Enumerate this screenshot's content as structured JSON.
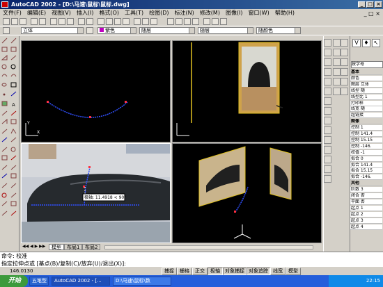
{
  "window": {
    "title": "AutoCAD 2002 - [D:\\马速\\鼠标\\鼠标.dwg]"
  },
  "menu": [
    "文件(F)",
    "编辑(E)",
    "视图(V)",
    "插入(I)",
    "格式(O)",
    "工具(T)",
    "绘图(D)",
    "标注(N)",
    "修改(M)",
    "图像(I)",
    "窗口(W)",
    "帮助(H)"
  ],
  "toolbar": {
    "layer_combo": "立体",
    "color_combo": "紫色",
    "linetype_combo": "随层",
    "lineweight_combo": "随层",
    "plotstyle_combo": "随颜色"
  },
  "dimension": {
    "label": "极轴: 11.4918 < 90°"
  },
  "layout_tabs": [
    "模型",
    "布局1",
    "布局2"
  ],
  "properties": {
    "dropdown": "按字母",
    "rows": [
      {
        "label": "基本",
        "group": true
      },
      {
        "label": "颜色",
        "group": false
      },
      {
        "label": "图层 立体",
        "group": false
      },
      {
        "label": "线型 随",
        "group": false
      },
      {
        "label": "线型比 1",
        "group": false
      },
      {
        "label": "打印样",
        "group": false
      },
      {
        "label": "线宽 随",
        "group": false
      },
      {
        "label": "超链接",
        "group": false
      },
      {
        "label": "图像",
        "group": true
      },
      {
        "label": "控制 1",
        "group": false
      },
      {
        "label": "控制 141.4",
        "group": false
      },
      {
        "label": "控制 15.15",
        "group": false
      },
      {
        "label": "控制 -146.",
        "group": false
      },
      {
        "label": "权值 -1",
        "group": false
      },
      {
        "label": "拟合 0",
        "group": false
      },
      {
        "label": "拟合 141.4",
        "group": false
      },
      {
        "label": "拟合 15.15",
        "group": false
      },
      {
        "label": "拟合 -146.",
        "group": false
      },
      {
        "label": "其他",
        "group": true
      },
      {
        "label": "阶数 3",
        "group": false
      },
      {
        "label": "闭合 否",
        "group": false
      },
      {
        "label": "平面 否",
        "group": false
      },
      {
        "label": "起点 1",
        "group": false
      },
      {
        "label": "起点 2",
        "group": false
      },
      {
        "label": "起点 3",
        "group": false
      },
      {
        "label": "起点 4",
        "group": false
      }
    ]
  },
  "command": {
    "line1": "命令: 校准",
    "line2": "指定拉伸点或 [基点(B)/复制(C)/放弃(U)/退出(X)]:"
  },
  "status": {
    "coords": "146.0130",
    "buttons": [
      "捕捉",
      "栅格",
      "正交",
      "极轴",
      "对象捕捉",
      "对象追踪",
      "线宽",
      "模型"
    ]
  },
  "taskbar": {
    "start": "开始",
    "lang": "五笔型",
    "tasks": [
      "AutoCAD 2002 - [...",
      "D:\\马速\\鼠标\\数"
    ],
    "clock": "22:15"
  }
}
